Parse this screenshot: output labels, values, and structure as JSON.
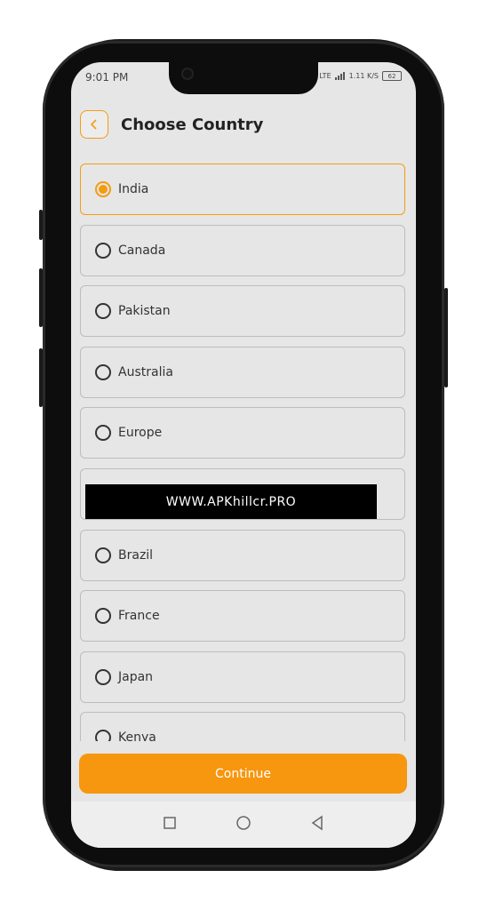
{
  "status_bar": {
    "time": "9:01 PM",
    "signal_text": "Vo LTE",
    "speed": "1.11 K/S",
    "battery": "62"
  },
  "header": {
    "title": "Choose Country",
    "back_icon": "chevron-left-icon"
  },
  "countries": [
    {
      "label": "India",
      "selected": true
    },
    {
      "label": "Canada",
      "selected": false
    },
    {
      "label": "Pakistan",
      "selected": false
    },
    {
      "label": "Australia",
      "selected": false
    },
    {
      "label": "Europe",
      "selected": false
    },
    {
      "label": "",
      "selected": false
    },
    {
      "label": "Brazil",
      "selected": false
    },
    {
      "label": "France",
      "selected": false
    },
    {
      "label": "Japan",
      "selected": false
    },
    {
      "label": "Kenya",
      "selected": false
    }
  ],
  "watermark": "WWW.APKhillcr.PRO",
  "continue_label": "Continue",
  "nav": {
    "recents_icon": "square-icon",
    "home_icon": "circle-icon",
    "back_icon": "triangle-back-icon"
  },
  "colors": {
    "accent": "#f7960f",
    "screen_bg": "#e6e6e6"
  }
}
